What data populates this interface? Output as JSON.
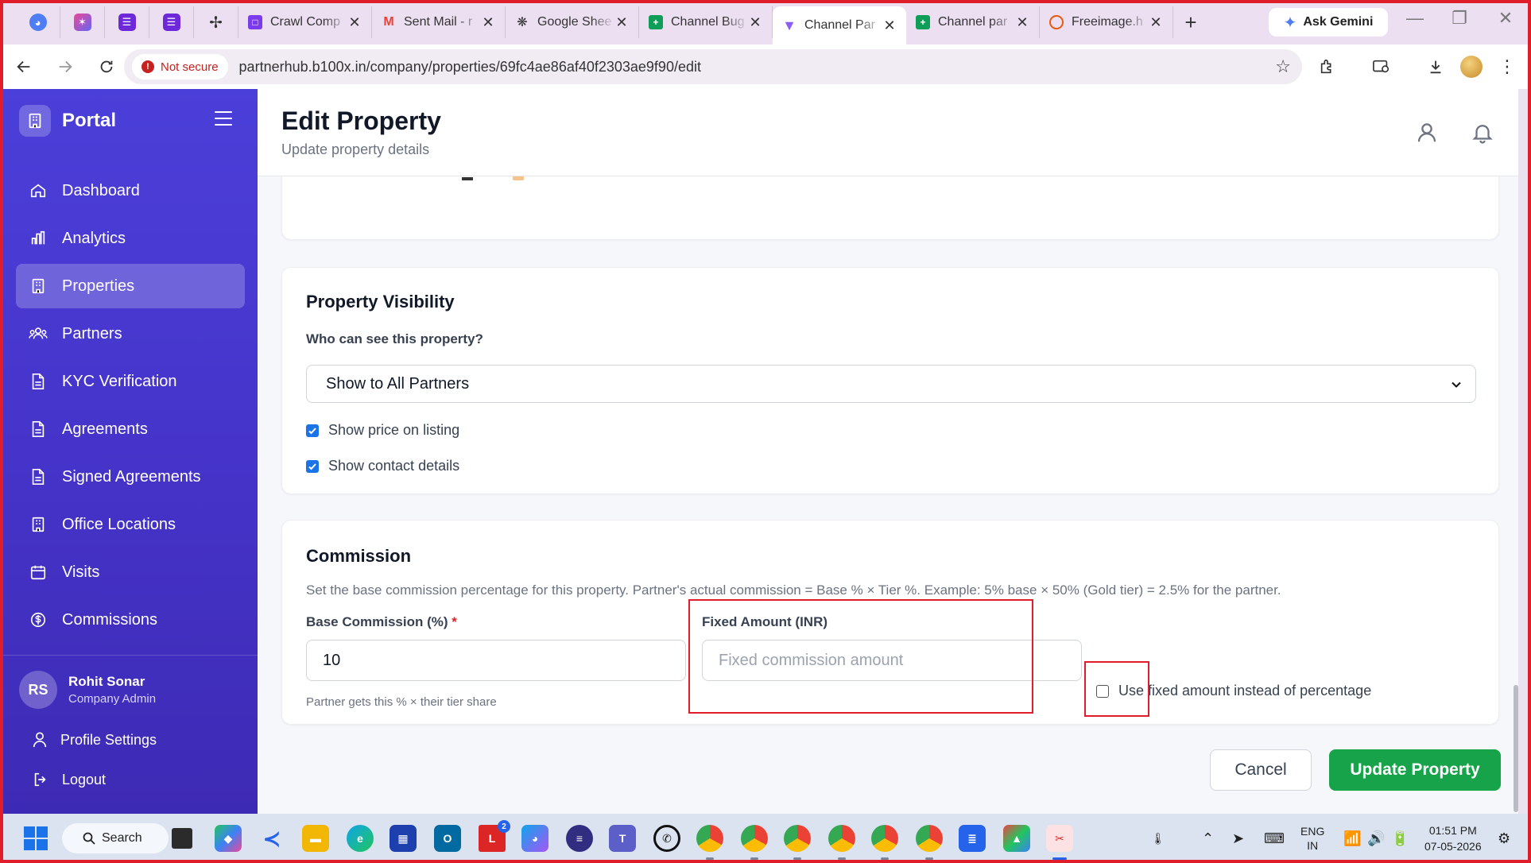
{
  "browser": {
    "tabs": [
      {
        "title": "Crawl Comp",
        "color": "#7c3aed"
      },
      {
        "title": "Sent Mail - r",
        "color": "#ea4335"
      },
      {
        "title": "Google Shee",
        "color": "#5f6368"
      },
      {
        "title": "Channel Bug",
        "color": "#0f9d58"
      },
      {
        "title": "Channel Par",
        "color": "#8b5cf6",
        "active": true
      },
      {
        "title": "Channel par",
        "color": "#0f9d58"
      },
      {
        "title": "Freeimage.h",
        "color": "#ea580c"
      }
    ],
    "gemini_label": "Ask Gemini",
    "not_secure_label": "Not secure",
    "url": "partnerhub.b100x.in/company/properties/69fc4ae86af40f2303ae9f90/edit"
  },
  "sidebar": {
    "brand": "Portal",
    "items": [
      {
        "label": "Dashboard",
        "icon": "home-icon"
      },
      {
        "label": "Analytics",
        "icon": "bar-chart-icon"
      },
      {
        "label": "Properties",
        "icon": "building-icon",
        "active": true
      },
      {
        "label": "Partners",
        "icon": "users-icon"
      },
      {
        "label": "KYC Verification",
        "icon": "document-icon"
      },
      {
        "label": "Agreements",
        "icon": "document-icon"
      },
      {
        "label": "Signed Agreements",
        "icon": "document-icon"
      },
      {
        "label": "Office Locations",
        "icon": "building-icon"
      },
      {
        "label": "Visits",
        "icon": "calendar-icon"
      },
      {
        "label": "Commissions",
        "icon": "dollar-circle-icon"
      }
    ],
    "user": {
      "initials": "RS",
      "name": "Rohit Sonar",
      "role": "Company Admin"
    },
    "profile_settings": "Profile Settings",
    "logout": "Logout"
  },
  "header": {
    "title": "Edit Property",
    "subtitle": "Update property details"
  },
  "visibility": {
    "title": "Property Visibility",
    "question": "Who can see this property?",
    "selected": "Show to All Partners",
    "show_price": {
      "label": "Show price on listing",
      "checked": true
    },
    "show_contact": {
      "label": "Show contact details",
      "checked": true
    }
  },
  "commission": {
    "title": "Commission",
    "description": "Set the base commission percentage for this property. Partner's actual commission = Base % × Tier %. Example: 5% base × 50% (Gold tier) = 2.5% for the partner.",
    "base_label": "Base Commission (%)",
    "required_mark": "*",
    "base_value": "10",
    "base_hint": "Partner gets this % × their tier share",
    "fixed_label": "Fixed Amount (INR)",
    "fixed_placeholder": "Fixed commission amount",
    "use_fixed_label": "Use fixed amount instead of percentage",
    "use_fixed_checked": false
  },
  "actions": {
    "cancel": "Cancel",
    "update": "Update Property"
  },
  "taskbar": {
    "search": "Search",
    "lang_top": "ENG",
    "lang_bottom": "IN",
    "time": "01:51 PM",
    "date": "07-05-2026",
    "teams_badge": "2"
  },
  "colors": {
    "sidebar": "#4b3fd9",
    "accent_green": "#16a34a",
    "annotation_red": "#e11d2c",
    "checkbox_blue": "#1a73e8"
  }
}
